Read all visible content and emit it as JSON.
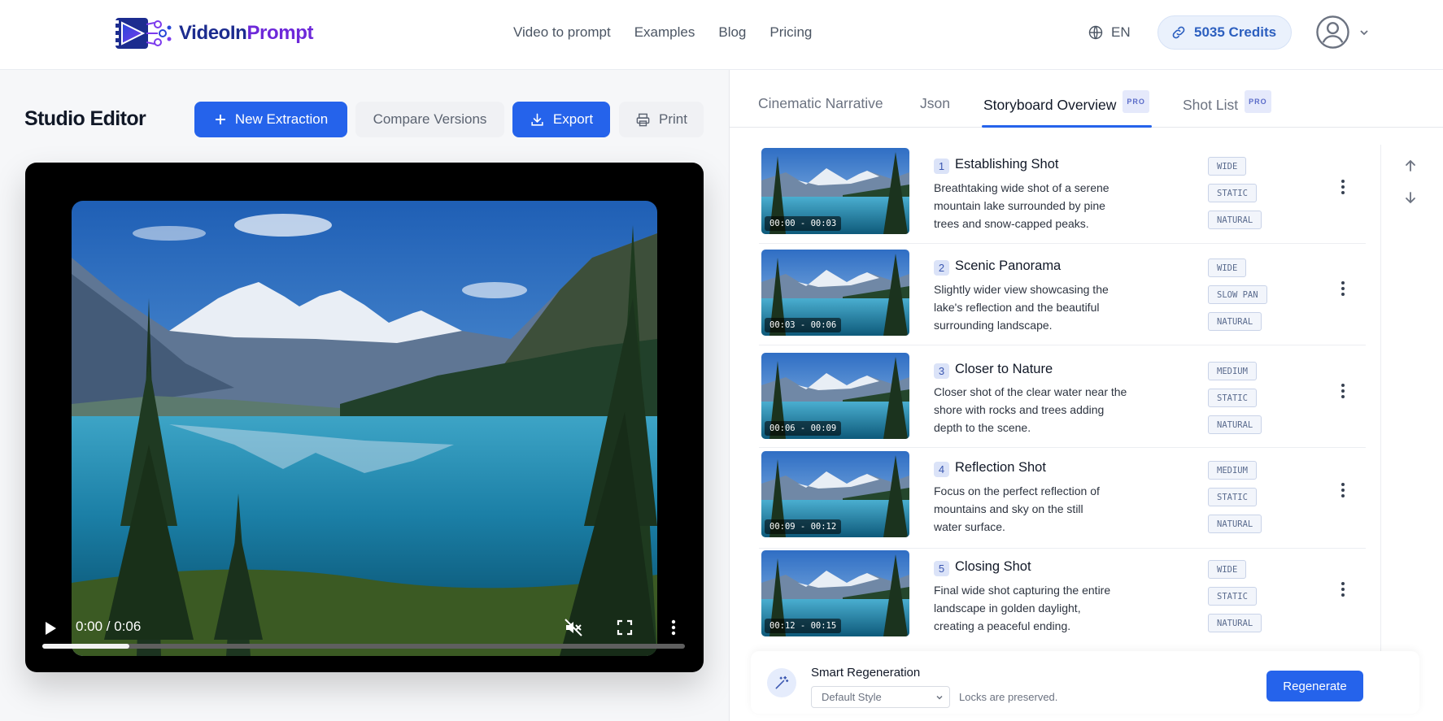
{
  "brand": {
    "name_part1": "VideoIn",
    "name_part2": "Prompt"
  },
  "nav": {
    "items": [
      "Video to prompt",
      "Examples",
      "Blog",
      "Pricing"
    ]
  },
  "header": {
    "language": "EN",
    "credits": "5035 Credits"
  },
  "editor": {
    "title": "Studio Editor",
    "new_extraction": "New Extraction",
    "compare_versions": "Compare Versions",
    "export": "Export",
    "print": "Print"
  },
  "player": {
    "time": "0:00 / 0:06",
    "progress": 0.135,
    "muted": true
  },
  "tabs": [
    {
      "label": "Cinematic Narrative",
      "pro": ""
    },
    {
      "label": "Json",
      "pro": ""
    },
    {
      "label": "Storyboard Overview",
      "pro": "PRO"
    },
    {
      "label": "Shot List",
      "pro": "PRO"
    }
  ],
  "active_tab": "Storyboard Overview",
  "scenes": [
    {
      "num": "1",
      "title": "Establishing Shot",
      "timecode": "00:00 - 00:03",
      "desc": [
        "Breathtaking wide shot of a serene",
        "mountain lake surrounded by pine",
        "trees and snow-capped peaks."
      ],
      "tags": [
        "WIDE",
        "STATIC",
        "NATURAL"
      ]
    },
    {
      "num": "2",
      "title": "Scenic Panorama",
      "timecode": "00:03 - 00:06",
      "desc": [
        "Slightly wider view showcasing the",
        "lake's reflection and the beautiful",
        "surrounding landscape."
      ],
      "tags": [
        "WIDE",
        "SLOW PAN",
        "NATURAL"
      ]
    },
    {
      "num": "3",
      "title": "Closer to Nature",
      "timecode": "00:06 - 00:09",
      "desc": [
        "Closer shot of the clear water near the",
        "shore with rocks and trees adding",
        "depth to the scene."
      ],
      "tags": [
        "MEDIUM",
        "STATIC",
        "NATURAL"
      ]
    },
    {
      "num": "4",
      "title": "Reflection Shot",
      "timecode": "00:09 - 00:12",
      "desc": [
        "Focus on the perfect reflection of",
        "mountains and sky on the still",
        "water surface."
      ],
      "tags": [
        "MEDIUM",
        "STATIC",
        "NATURAL"
      ]
    },
    {
      "num": "5",
      "title": "Closing Shot",
      "timecode": "00:12 - 00:15",
      "desc": [
        "Final wide shot capturing the entire",
        "landscape in golden daylight,",
        "creating a peaceful ending."
      ],
      "tags": [
        "WIDE",
        "STATIC",
        "NATURAL"
      ]
    }
  ],
  "regen": {
    "title": "Smart Regeneration",
    "style_selected": "Default Style",
    "note": "Locks are preserved.",
    "button": "Regenerate"
  },
  "colors": {
    "accent": "#2563eb",
    "brand_dark": "#1c2c8f",
    "brand_purple": "#6d28d9",
    "tag_text": "#5a6b8e"
  },
  "icons": [
    "globe-icon",
    "link-icon",
    "user-avatar-icon",
    "chevron-down-icon",
    "plus-icon",
    "download-icon",
    "printer-icon",
    "play-icon",
    "mute-icon",
    "fullscreen-icon",
    "more-vertical-icon",
    "arrow-up-icon",
    "arrow-down-icon",
    "magic-wand-icon"
  ]
}
